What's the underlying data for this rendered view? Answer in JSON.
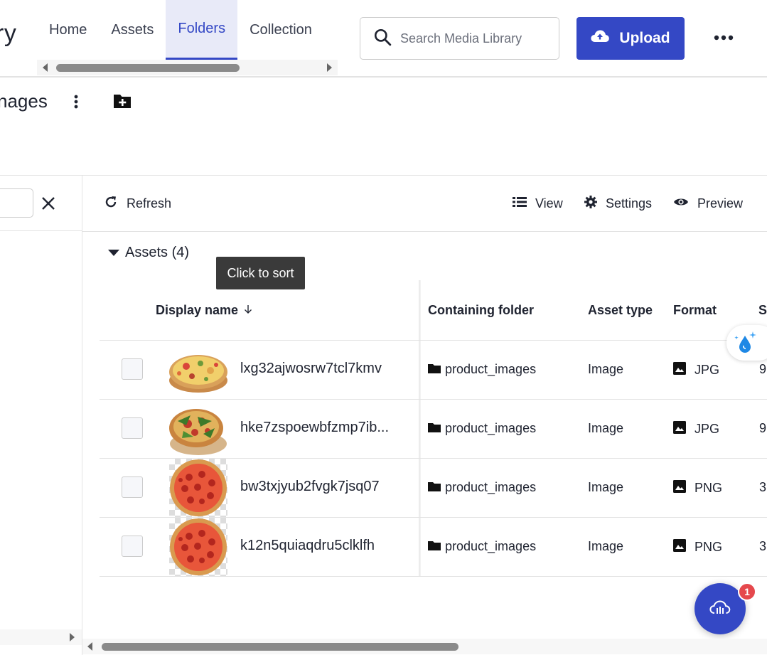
{
  "header": {
    "app_title_fragment": "ry",
    "tabs": [
      {
        "label": "Home",
        "active": false
      },
      {
        "label": "Assets",
        "active": false
      },
      {
        "label": "Folders",
        "active": true
      },
      {
        "label": "Collection",
        "active": false
      }
    ],
    "search_placeholder": "Search Media Library",
    "upload_label": "Upload",
    "more_icon": "more-horizontal-icon"
  },
  "folder": {
    "title_fragment": "nages",
    "more_icon": "more-vertical-icon",
    "new_folder_icon": "folder-plus-icon"
  },
  "toolbar": {
    "refresh_label": "Refresh",
    "view_label": "View",
    "settings_label": "Settings",
    "preview_label": "Preview"
  },
  "assets_heading": "Assets (4)",
  "tooltip": "Click to sort",
  "table": {
    "columns": {
      "display_name": "Display name",
      "containing_folder": "Containing folder",
      "asset_type": "Asset type",
      "format": "Format",
      "size": "S"
    },
    "rows": [
      {
        "name": "lxg32ajwosrw7tcl7kmv",
        "folder": "product_images",
        "type": "Image",
        "format": "JPG",
        "size": "9"
      },
      {
        "name": "hke7zspoewbfzmp7ib...",
        "folder": "product_images",
        "type": "Image",
        "format": "JPG",
        "size": "9"
      },
      {
        "name": "bw3txjyub2fvgk7jsq07",
        "folder": "product_images",
        "type": "Image",
        "format": "PNG",
        "size": "3"
      },
      {
        "name": "k12n5quiaqdru5clklfh",
        "folder": "product_images",
        "type": "Image",
        "format": "PNG",
        "size": "3"
      }
    ]
  },
  "notification_badge": "1",
  "colors": {
    "accent": "#3448c5",
    "badge": "#e5484d"
  }
}
